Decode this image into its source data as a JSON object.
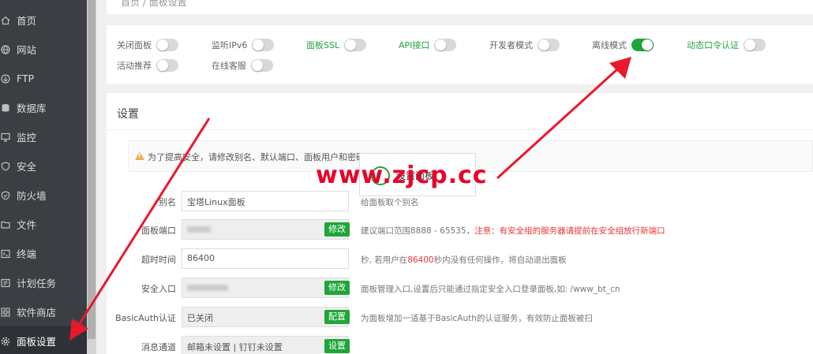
{
  "breadcrumb": "首页 / 面板设置",
  "sidebar": {
    "items": [
      {
        "label": "首页",
        "icon": "home-icon"
      },
      {
        "label": "网站",
        "icon": "globe-icon"
      },
      {
        "label": "FTP",
        "icon": "ftp-icon"
      },
      {
        "label": "数据库",
        "icon": "database-icon"
      },
      {
        "label": "监控",
        "icon": "monitor-icon"
      },
      {
        "label": "安全",
        "icon": "shield-icon"
      },
      {
        "label": "防火墙",
        "icon": "firewall-icon"
      },
      {
        "label": "文件",
        "icon": "folder-icon"
      },
      {
        "label": "终端",
        "icon": "terminal-icon"
      },
      {
        "label": "计划任务",
        "icon": "clock-icon"
      },
      {
        "label": "软件商店",
        "icon": "grid-icon"
      },
      {
        "label": "面板设置",
        "icon": "gear-icon"
      }
    ],
    "active": "面板设置"
  },
  "toggles": [
    {
      "label": "关闭面板",
      "on": false,
      "green": false
    },
    {
      "label": "监听IPv6",
      "on": false,
      "green": false
    },
    {
      "label": "面板SSL",
      "on": false,
      "green": true
    },
    {
      "label": "API接口",
      "on": false,
      "green": true
    },
    {
      "label": "开发者模式",
      "on": false,
      "green": false
    },
    {
      "label": "离线模式",
      "on": true,
      "green": false
    },
    {
      "label": "动态口令认证",
      "on": false,
      "green": true
    },
    {
      "label": "活动推荐",
      "on": false,
      "green": false
    },
    {
      "label": "在线客服",
      "on": false,
      "green": false
    }
  ],
  "settings": {
    "title": "设置",
    "warning": "为了提高安全，请修改别名、默认端口、面板用户和密码!",
    "card_text": "设置面板",
    "rows": [
      {
        "label": "别名",
        "value": "宝塔Linux面板",
        "button": "",
        "hint": "给面板取个别名",
        "hint_red": ""
      },
      {
        "label": "面板端口",
        "value": "",
        "button": "修改",
        "hint": "建议端口范围8888 - 65535，",
        "hint_red": "注意：有安全组的服务器请提前在安全组放行新端口"
      },
      {
        "label": "超时时间",
        "value": "86400",
        "button": "",
        "hint_pre": "秒, 若用户在",
        "hint_num": "86400",
        "hint_post": "秒内没有任何操作，将自动退出面板"
      },
      {
        "label": "安全入口",
        "value": "",
        "button": "修改",
        "hint": "面板管理入口,设置后只能通过指定安全入口登录面板,如: /www_bt_cn",
        "hint_red": ""
      },
      {
        "label": "BasicAuth认证",
        "value": "已关闭",
        "button": "配置",
        "hint": "为面板增加一道基于BasicAuth的认证服务，有效防止面板被扫",
        "hint_red": ""
      },
      {
        "label": "消息通道",
        "value": "邮箱未设置 | 钉钉未设置",
        "button": "设置",
        "hint": "",
        "hint_red": ""
      }
    ]
  },
  "watermark": "www.zjcp.cc",
  "colors": {
    "accent": "#20a53a",
    "sidebar": "#3b3f44",
    "arrow": "#e8192c"
  }
}
